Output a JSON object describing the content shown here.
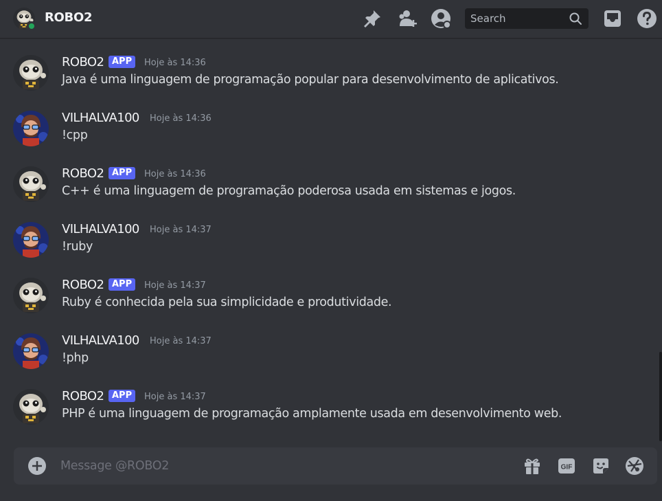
{
  "header": {
    "title": "ROBO2",
    "search_placeholder": "Search",
    "icons": [
      "pin-icon",
      "add-friend-icon",
      "user-profile-icon",
      "search-icon",
      "inbox-icon",
      "help-icon"
    ]
  },
  "messages": [
    {
      "author": "ROBO2",
      "is_app": true,
      "badge": "APP",
      "time": "Hoje às 14:36",
      "text": "Java é uma linguagem de programação popular para desenvolvimento de aplicativos."
    },
    {
      "author": "VILHALVA100",
      "is_app": false,
      "badge": "",
      "time": "Hoje às 14:36",
      "text": "!cpp"
    },
    {
      "author": "ROBO2",
      "is_app": true,
      "badge": "APP",
      "time": "Hoje às 14:36",
      "text": "C++ é uma linguagem de programação poderosa usada em sistemas e jogos."
    },
    {
      "author": "VILHALVA100",
      "is_app": false,
      "badge": "",
      "time": "Hoje às 14:37",
      "text": "!ruby"
    },
    {
      "author": "ROBO2",
      "is_app": true,
      "badge": "APP",
      "time": "Hoje às 14:37",
      "text": "Ruby é conhecida pela sua simplicidade e produtividade."
    },
    {
      "author": "VILHALVA100",
      "is_app": false,
      "badge": "",
      "time": "Hoje às 14:37",
      "text": "!php"
    },
    {
      "author": "ROBO2",
      "is_app": true,
      "badge": "APP",
      "time": "Hoje às 14:37",
      "text": "PHP é uma linguagem de programação amplamente usada em desenvolvimento web."
    }
  ],
  "composer": {
    "placeholder": "Message @ROBO2",
    "icons": [
      "add-attachment-icon",
      "gift-icon",
      "gif-icon",
      "sticker-icon",
      "emoji-icon"
    ]
  },
  "colors": {
    "background": "#313338",
    "app_badge": "#5865f2",
    "online_status": "#23a55a",
    "composer": "#383a40",
    "search_bg": "#1e1f22"
  }
}
